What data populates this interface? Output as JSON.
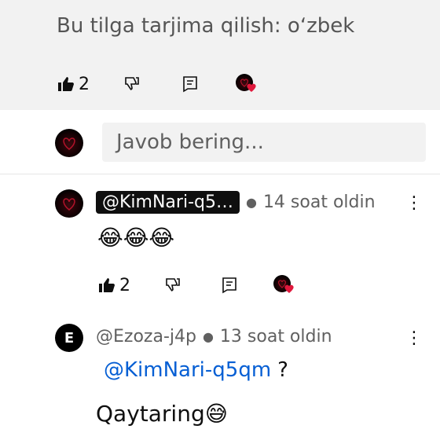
{
  "top_comment": {
    "translate_text": "Bu tilga tarjima qilish: oʻzbek",
    "like_count": "2"
  },
  "reply_box": {
    "placeholder": "Javob bering..."
  },
  "reply1": {
    "author": "@KimNari-q5…",
    "time": "14 soat oldin",
    "body": "😂😂😂",
    "like_count": "2"
  },
  "reply2": {
    "avatar_letter": "E",
    "author": "@Ezoza-j4p",
    "time": "13 soat oldin",
    "mention": "@KimNari-q5qm",
    "mention_suffix": "?",
    "body": "Qaytaring😅"
  },
  "icons": [
    "thumbs-up-icon",
    "thumbs-down-icon",
    "reply-icon",
    "creator-heart-icon",
    "more-vert-icon"
  ],
  "colors": {
    "link": "#065fd4",
    "heart": "#e0183c",
    "input_bg": "#f2f2f2"
  }
}
